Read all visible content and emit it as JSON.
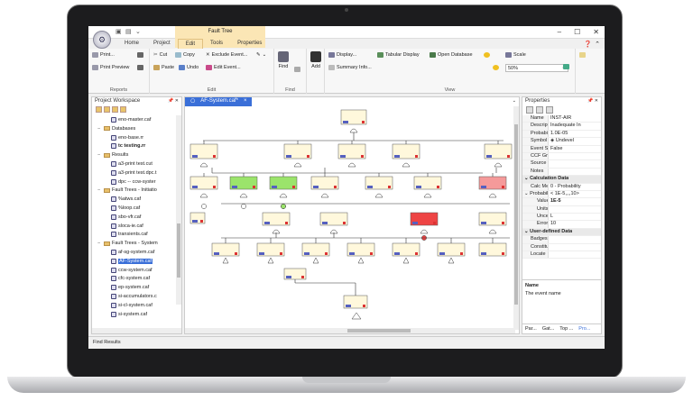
{
  "window": {
    "title": "Fault Tree"
  },
  "ribbon_tabs": [
    "Home",
    "Project",
    "Edit",
    "Tools",
    "Properties"
  ],
  "ribbon": {
    "reports": {
      "label": "Reports",
      "print": "Print...",
      "print_preview": "Print Preview"
    },
    "edit": {
      "label": "Edit",
      "cut": "Cut",
      "copy": "Copy",
      "exclude_event": "Exclude Event...",
      "paste": "Paste",
      "undo": "Undo",
      "edit_event": "Edit Event..."
    },
    "find": {
      "label": "Find",
      "find_btn": "Find",
      "add": "Add"
    },
    "view": {
      "label": "View",
      "display": "Display...",
      "tabular": "Tabular Display",
      "open_db": "Open Database",
      "summary": "Summary Info...",
      "scale": "Scale",
      "scale_value": "50%"
    }
  },
  "sidebar": {
    "title": "Project Workspace",
    "items": [
      {
        "label": "eno-master.caf",
        "kind": "file",
        "indent": 2
      },
      {
        "label": "Databases",
        "kind": "folder",
        "indent": 1
      },
      {
        "label": "eno-base.rr",
        "kind": "file",
        "indent": 2
      },
      {
        "label": "tc testing.rr",
        "kind": "file",
        "indent": 2,
        "bold": true
      },
      {
        "label": "Results",
        "kind": "folder",
        "indent": 1
      },
      {
        "label": "a3-print test.cut",
        "kind": "file",
        "indent": 2
      },
      {
        "label": "a3-print test.dpc.t",
        "kind": "file",
        "indent": 2
      },
      {
        "label": "dpc -- ccw-syster",
        "kind": "file",
        "indent": 2
      },
      {
        "label": "Fault Trees - Initiatio",
        "kind": "folder",
        "indent": 1
      },
      {
        "label": "%atws.caf",
        "kind": "file",
        "indent": 2
      },
      {
        "label": "%loop.caf",
        "kind": "file",
        "indent": 2
      },
      {
        "label": "sbo-vfr.caf",
        "kind": "file",
        "indent": 2
      },
      {
        "label": "sloca-ie.caf",
        "kind": "file",
        "indent": 2
      },
      {
        "label": "transients.caf",
        "kind": "file",
        "indent": 2
      },
      {
        "label": "Fault Trees - System",
        "kind": "folder",
        "indent": 1
      },
      {
        "label": "af-sg-system.caf",
        "kind": "file",
        "indent": 2
      },
      {
        "label": "AF-System.caf",
        "kind": "file",
        "indent": 2,
        "selected": true
      },
      {
        "label": "ccw-system.caf",
        "kind": "file",
        "indent": 2
      },
      {
        "label": "cfc-system.caf",
        "kind": "file",
        "indent": 2
      },
      {
        "label": "ep-system.caf",
        "kind": "file",
        "indent": 2
      },
      {
        "label": "si-accumulators.c",
        "kind": "file",
        "indent": 2
      },
      {
        "label": "si-cl-system.caf",
        "kind": "file",
        "indent": 2
      },
      {
        "label": "si-system.caf",
        "kind": "file",
        "indent": 2
      }
    ]
  },
  "document": {
    "tab": "AF-System.caf*",
    "close": "×"
  },
  "properties": {
    "title": "Properties",
    "rows": [
      {
        "k": "Name",
        "v": "INST-AIR"
      },
      {
        "k": "Descriptio",
        "v": "Inadequate In"
      },
      {
        "k": "Probabilit",
        "v": "1.0E-05"
      },
      {
        "k": "Symbol",
        "v": "◈  Undevel"
      },
      {
        "k": "Event Stat",
        "v": "False"
      },
      {
        "k": "CCF Grou",
        "v": ""
      },
      {
        "k": "Source",
        "v": ""
      },
      {
        "k": "Notes",
        "v": ""
      },
      {
        "k": "Calculation Data",
        "v": "",
        "cat": true
      },
      {
        "k": "Calc Met",
        "v": "0 - Probability"
      },
      {
        "k": "Probabilit",
        "v": "< 1E-5,,,,10>",
        "exp": true
      },
      {
        "k": "Value",
        "v": "1E-5",
        "bold": true,
        "sub": true
      },
      {
        "k": "Units",
        "v": "",
        "sub": true
      },
      {
        "k": "Unce",
        "v": "L",
        "sub": true
      },
      {
        "k": "Error",
        "v": "10",
        "sub": true
      },
      {
        "k": "User-defined Data",
        "v": "",
        "cat": true
      },
      {
        "k": "Badges",
        "v": ""
      },
      {
        "k": "Constitue",
        "v": ""
      },
      {
        "k": "Locate",
        "v": ""
      }
    ],
    "desc_title": "Name",
    "desc_text": "The event name",
    "tabs": [
      "Par...",
      "Gat...",
      "Top ...",
      "Pro..."
    ]
  },
  "footer": {
    "find_results": "Find Results"
  },
  "colors": {
    "accent": "#3a6fd8",
    "tab_highlight": "#fbe6b5",
    "gate_green": "#9be46b",
    "gate_red": "#ee4444",
    "gate_pink": "#f59a9a",
    "node_fill": "#fff8dc"
  }
}
